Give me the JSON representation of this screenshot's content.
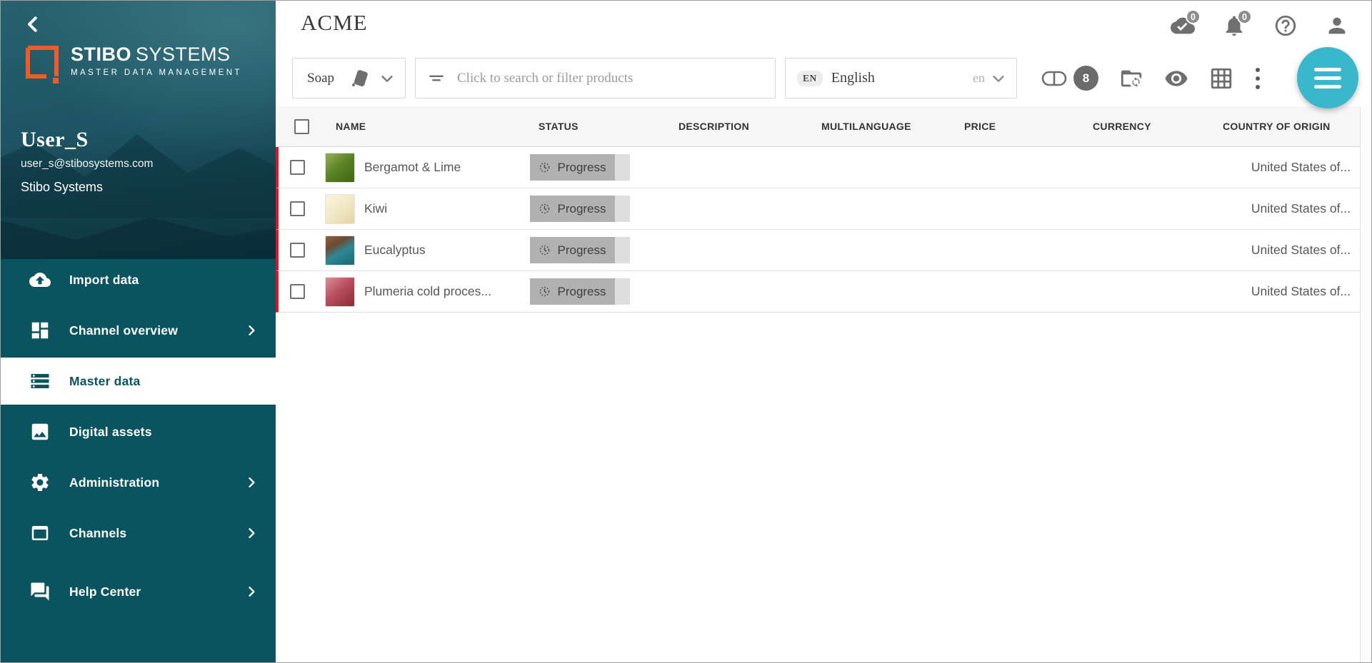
{
  "sidebar": {
    "logo": {
      "brand_bold": "STIBO",
      "brand_light": "SYSTEMS",
      "tagline": "MASTER DATA MANAGEMENT"
    },
    "user": {
      "name": "User_S",
      "email": "user_s@stibosystems.com",
      "organization": "Stibo Systems"
    },
    "items": [
      {
        "label": "Import data"
      },
      {
        "label": "Channel overview"
      },
      {
        "label": "Master data"
      },
      {
        "label": "Digital assets"
      },
      {
        "label": "Administration"
      },
      {
        "label": "Channels"
      },
      {
        "label": "Help Center"
      }
    ]
  },
  "header": {
    "title": "ACME",
    "sync_badge": "0",
    "notifications_badge": "0"
  },
  "toolbar": {
    "category": {
      "label": "Soap"
    },
    "search": {
      "placeholder": "Click to search or filter products"
    },
    "language": {
      "badge": "EN",
      "name": "English",
      "code": "en"
    },
    "basket_badge": "8"
  },
  "table": {
    "columns": {
      "name": "NAME",
      "status": "STATUS",
      "description": "DESCRIPTION",
      "multilanguage": "MULTILANGUAGE",
      "price": "PRICE",
      "currency": "CURRENCY",
      "country": "COUNTRY OF ORIGIN"
    },
    "rows": [
      {
        "name": "Bergamot & Lime",
        "status": "Progress",
        "country": "United States of..."
      },
      {
        "name": "Kiwi",
        "status": "Progress",
        "country": "United States of..."
      },
      {
        "name": "Eucalyptus",
        "status": "Progress",
        "country": "United States of..."
      },
      {
        "name": "Plumeria cold proces...",
        "status": "Progress",
        "country": "United States of..."
      }
    ]
  },
  "colors": {
    "sidebar_teal": "#0a5460",
    "accent_red": "#d9152b",
    "fab_teal": "#3ab7cb",
    "logo_orange": "#f15b2b"
  }
}
